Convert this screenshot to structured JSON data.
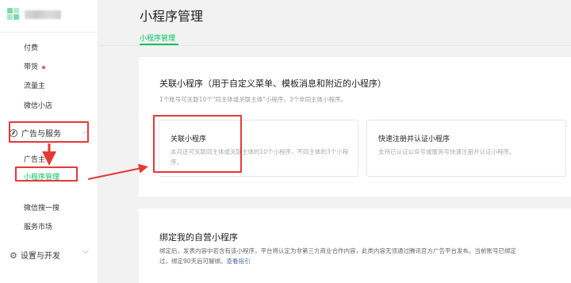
{
  "sidebar": {
    "items_top": [
      {
        "label": "付费"
      },
      {
        "label": "带货"
      },
      {
        "label": "流量主"
      },
      {
        "label": "微信小店"
      }
    ],
    "group_ads": {
      "label": "广告与服务"
    },
    "ads_items": [
      {
        "label": "广告主"
      },
      {
        "label": "小程序管理"
      }
    ],
    "items_bottom": [
      {
        "label": "微信搜一搜"
      },
      {
        "label": "服务市场"
      }
    ],
    "group_dev": {
      "label": "设置与开发"
    }
  },
  "header": {
    "title": "小程序管理",
    "tab": "小程序管理"
  },
  "section_link": {
    "title": "关联小程序（用于自定义菜单、模板消息和附近的小程序）",
    "subtitle": "1个账号可关联10个\"同主体或关联主体\"小程序，3个非同主体小程序。",
    "option_link": {
      "title": "关联小程序",
      "desc": "本月还可关联同主体或关联主体的10个小程序，不同主体的3个小程序。"
    },
    "option_register": {
      "title": "快速注册并认证小程序",
      "desc": "支持已认证公众号或服务号快速注册并认证小程序。"
    }
  },
  "section_bind": {
    "title": "绑定我的自营小程序",
    "line1": "绑定后，发表内容中若含有该小程序，平台将认定为非第三方商业合作内容，此类内容无须通过腾讯官方广告平台发布。当前账号已绑定",
    "line2_prefix": "过，绑定90天后可解绑。",
    "line2_link": "查看指引"
  },
  "colors": {
    "accent": "#07c160",
    "annotation": "#e53935",
    "link": "#576b95"
  }
}
